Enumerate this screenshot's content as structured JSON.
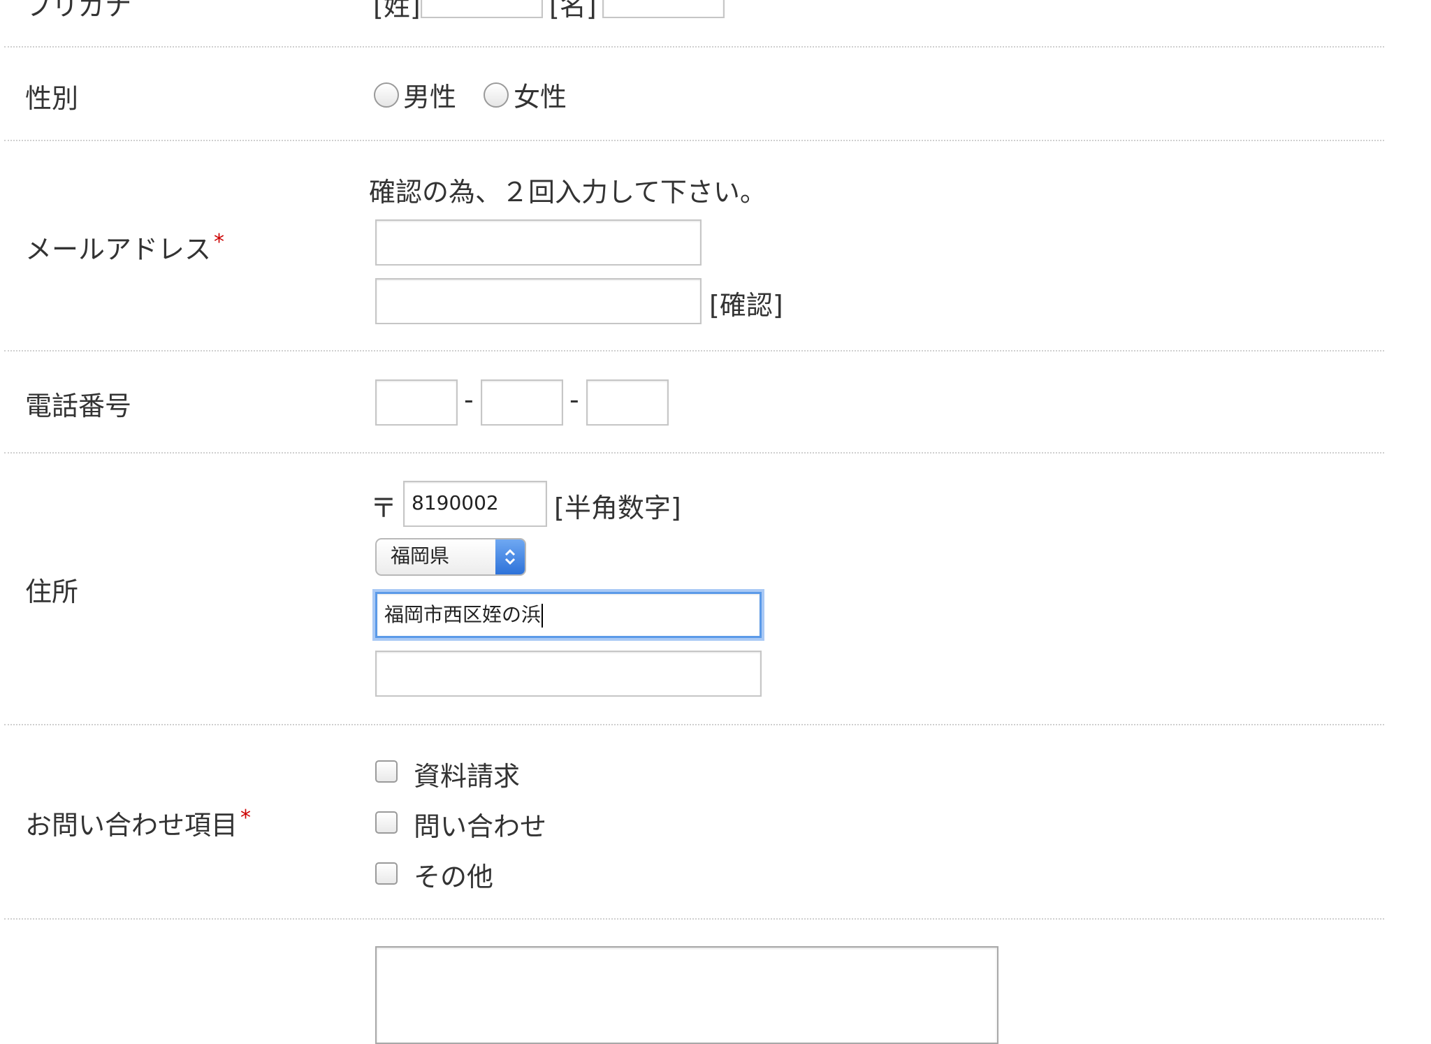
{
  "furigana": {
    "label": "フリガナ",
    "sei_label": "[姓]",
    "mei_label": "[名]"
  },
  "gender": {
    "label": "性別",
    "options": [
      "男性",
      "女性"
    ]
  },
  "email": {
    "label": "メールアドレス",
    "required_mark": "*",
    "note": "確認の為、２回入力して下さい。",
    "confirm_label": "[確認]"
  },
  "phone": {
    "label": "電話番号",
    "separator": "-"
  },
  "address": {
    "label": "住所",
    "postal_mark": "〒",
    "postal_value": "8190002",
    "postal_hint": "[半角数字]",
    "prefecture_selected": "福岡県",
    "address1_value": "福岡市西区姪の浜",
    "address2_value": ""
  },
  "inquiry": {
    "label": "お問い合わせ項目",
    "required_mark": "*",
    "options": [
      "資料請求",
      "問い合わせ",
      "その他"
    ]
  },
  "colors": {
    "required": "#cc0000",
    "focus": "#5b9ae8",
    "select_accent": "#2d72d9"
  }
}
